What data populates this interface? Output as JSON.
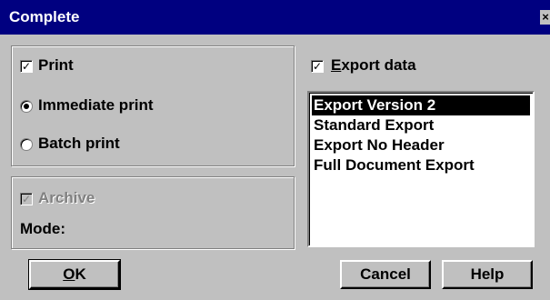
{
  "window": {
    "title": "Complete",
    "close_glyph": "×"
  },
  "print_group": {
    "print_label": "Print",
    "print_checked": true,
    "immediate_label": "Immediate print",
    "batch_label": "Batch print",
    "selected_mode": "immediate"
  },
  "archive_group": {
    "archive_label": "Archive",
    "archive_checked": true,
    "archive_enabled": false,
    "mode_label": "Mode:"
  },
  "export": {
    "checkbox_label_access": "E",
    "checkbox_label_rest": "xport data",
    "checked": true,
    "items": [
      {
        "label": "Export Version 2",
        "selected": true
      },
      {
        "label": "Standard Export",
        "selected": false
      },
      {
        "label": "Export No Header",
        "selected": false
      },
      {
        "label": "Full Document Export",
        "selected": false
      }
    ]
  },
  "buttons": {
    "ok_access": "O",
    "ok_rest": "K",
    "cancel": "Cancel",
    "help": "Help"
  },
  "icons": {
    "check_glyph": "✓"
  },
  "colors": {
    "title_bar": "#000080",
    "face": "#c0c0c0",
    "selection": "#000000"
  }
}
